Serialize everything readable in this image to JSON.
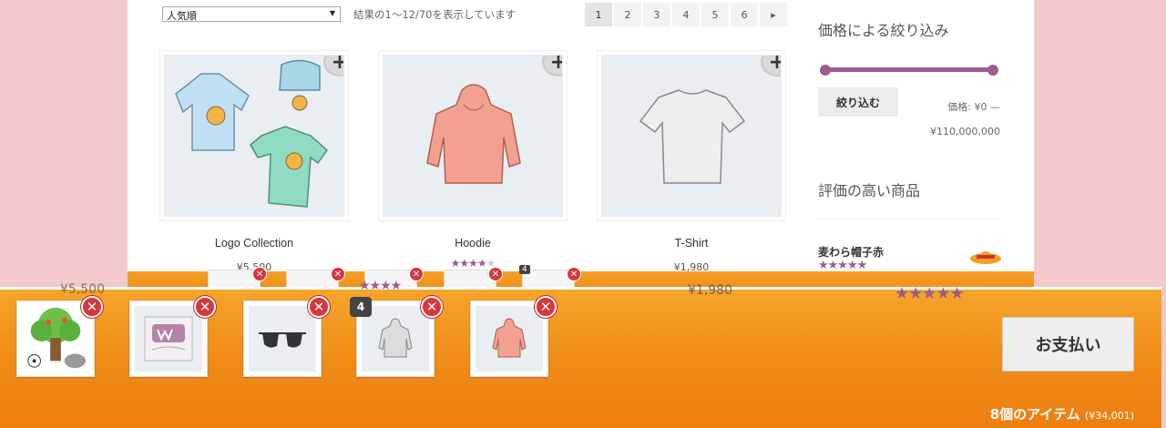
{
  "toolbar": {
    "sort_value": "人気順",
    "result_count": "結果の1〜12/70を表示しています"
  },
  "pagination": [
    "1",
    "2",
    "3",
    "4",
    "5",
    "6"
  ],
  "pagination_next": "▸",
  "products": [
    {
      "name": "Logo Collection",
      "price": "¥5,500",
      "add": "+"
    },
    {
      "name": "Hoodie",
      "rating": 4,
      "add": "+"
    },
    {
      "name": "T-Shirt",
      "price": "¥1,980",
      "add": "+"
    }
  ],
  "sidebar": {
    "price_filter_title": "価格による絞り込み",
    "filter_button": "絞り込む",
    "price_range_line1": "価格: ¥0 —",
    "price_range_line2": "¥110,000,000",
    "top_rated_title": "評価の高い商品",
    "top_rated_item": "麦わら帽子赤",
    "top_rated_stars": "★★★★★"
  },
  "cart": {
    "items": [
      {
        "name": "tree-animals",
        "qty": ""
      },
      {
        "name": "woo-poster",
        "qty": ""
      },
      {
        "name": "sunglasses",
        "qty": ""
      },
      {
        "name": "gray-hoodie",
        "qty": "4"
      },
      {
        "name": "pink-hoodie",
        "qty": ""
      }
    ],
    "remove_glyph": "✕",
    "checkout_label": "お支払い",
    "summary": "8個のアイテム",
    "total": "(¥34,001)"
  },
  "overlap": {
    "price_left": "¥5,500",
    "price_mid": "¥1,980",
    "stars_right": "★★★★★",
    "stars_left": "★★★★",
    "ghost_qty": "4"
  },
  "colors": {
    "accent": "#9b5c8f",
    "cart_orange": "#ef8a18",
    "remove_red": "#d9363e"
  }
}
